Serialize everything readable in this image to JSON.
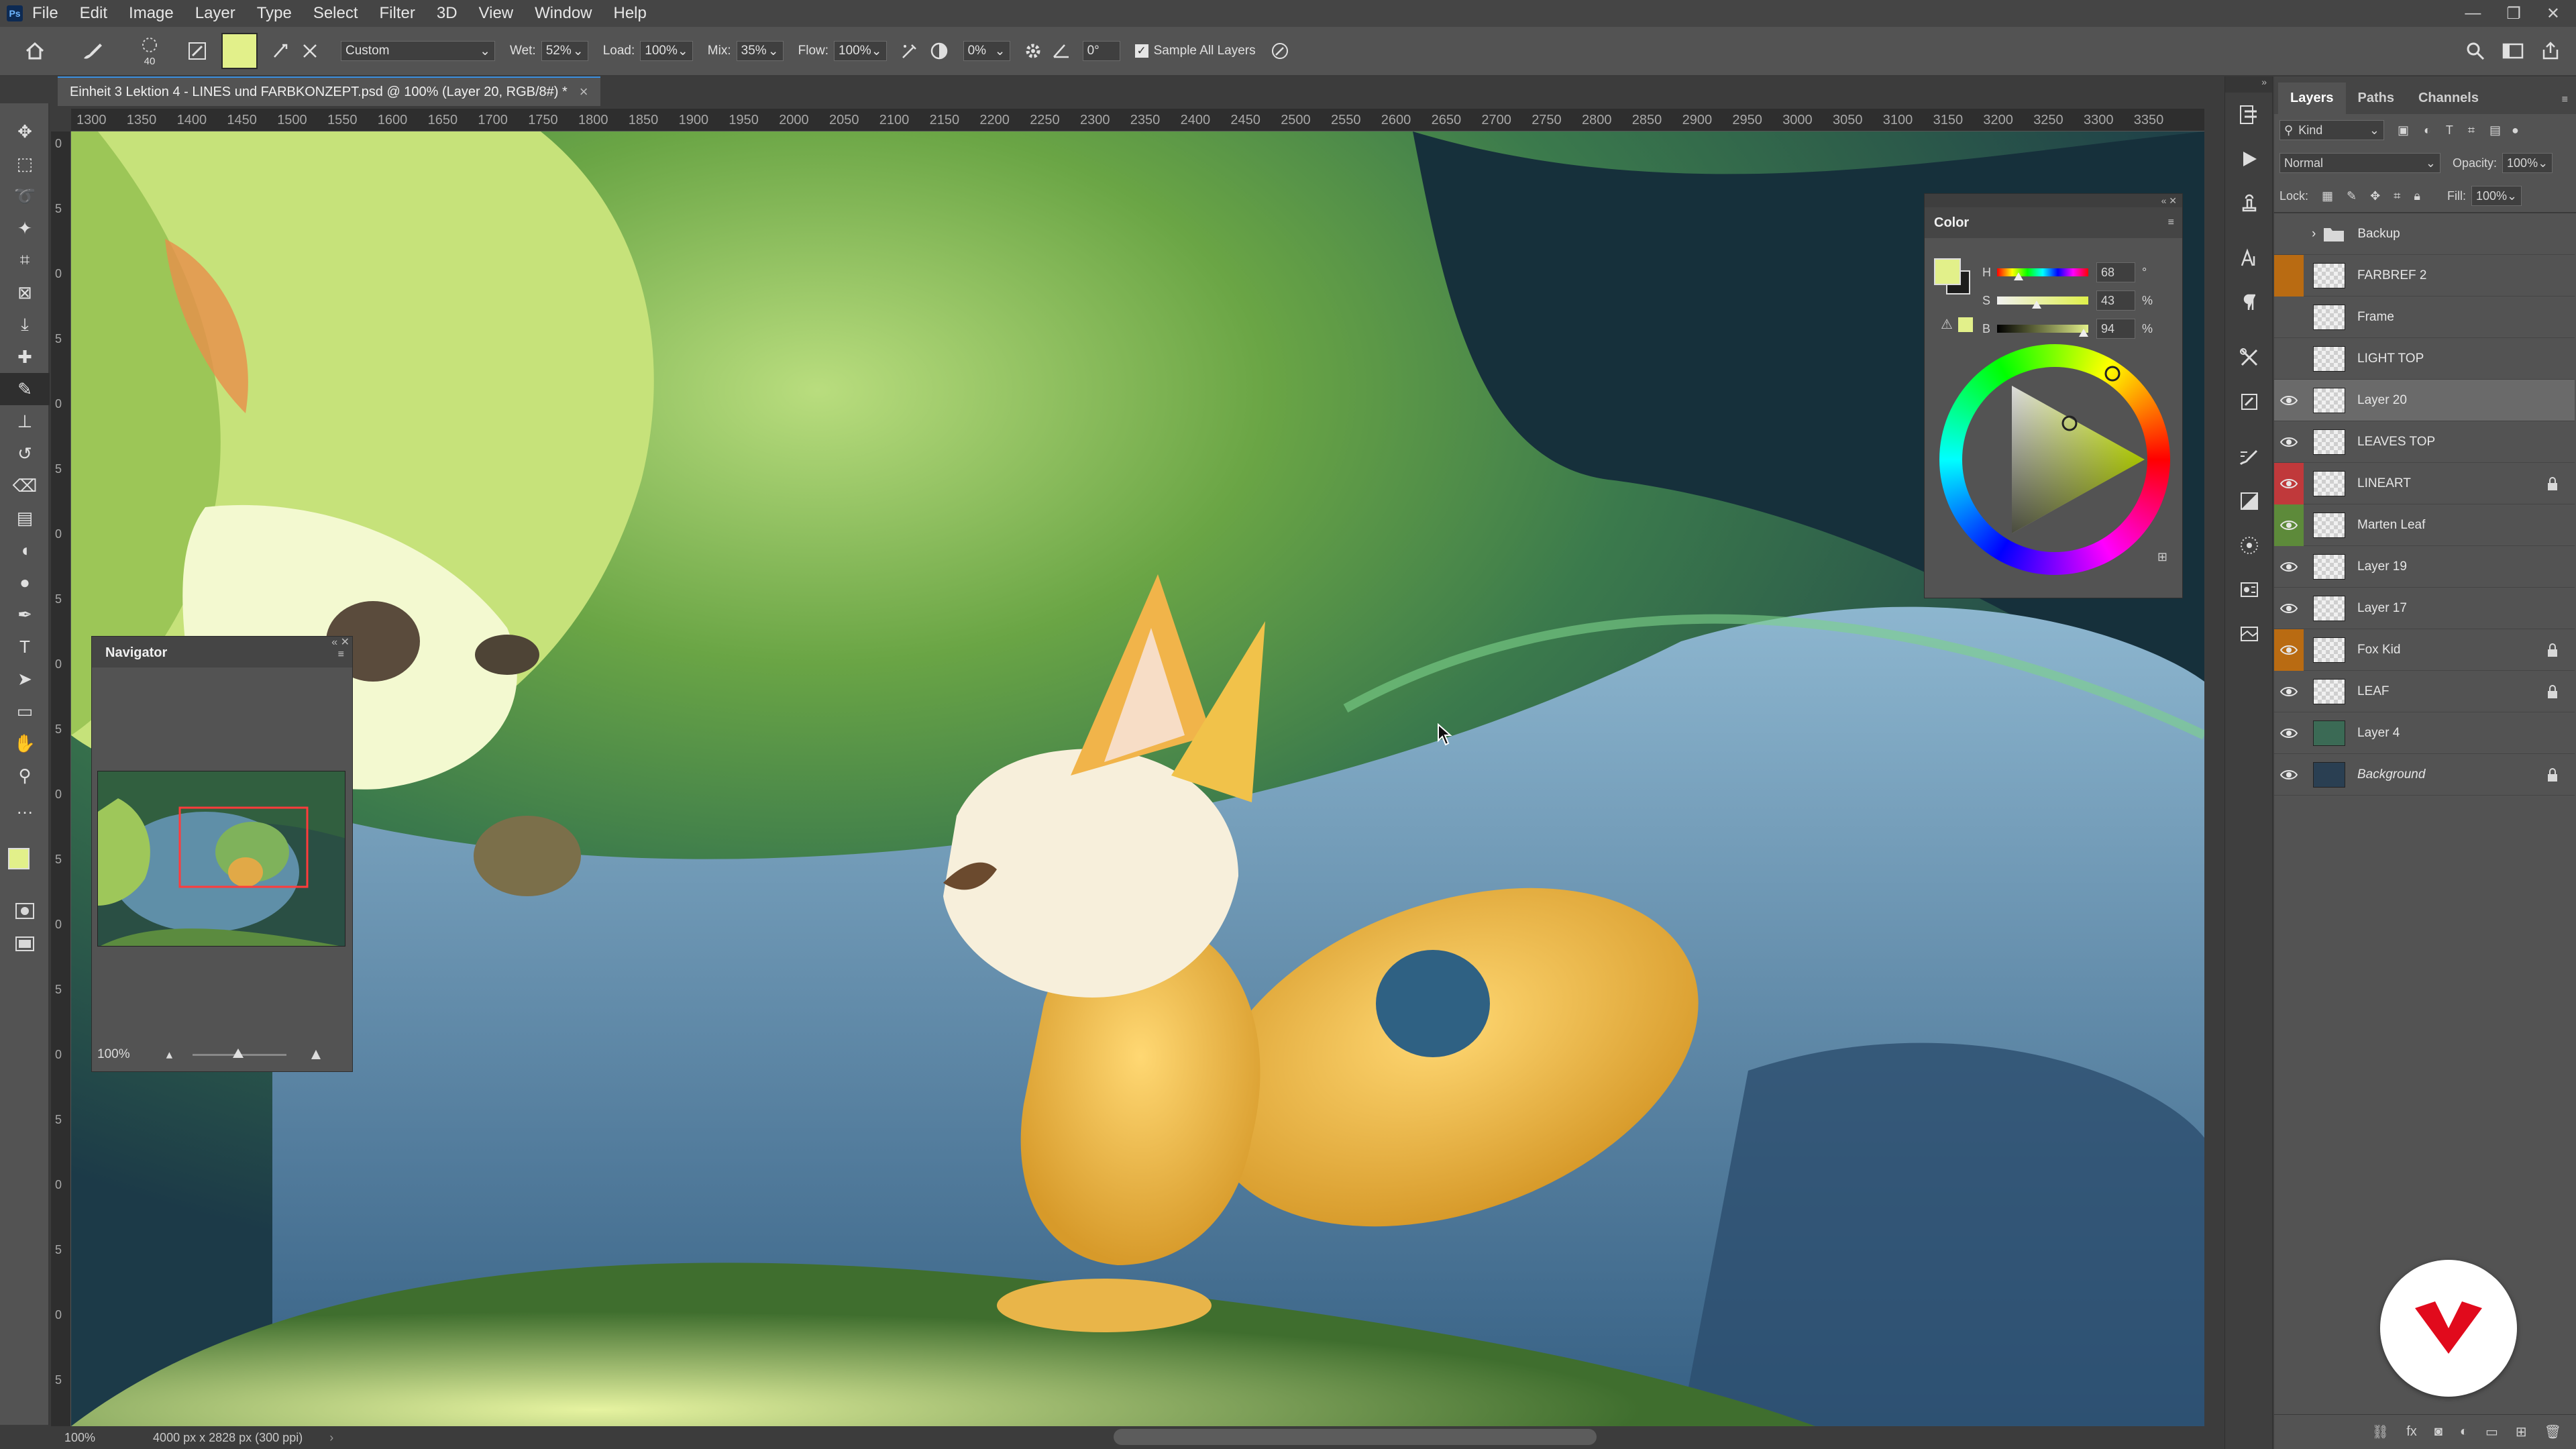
{
  "app": {
    "logo_text": "Ps"
  },
  "menu": [
    "File",
    "Edit",
    "Image",
    "Layer",
    "Type",
    "Select",
    "Filter",
    "3D",
    "View",
    "Window",
    "Help"
  ],
  "window_controls": {
    "minimize": "—",
    "restore": "❐",
    "close": "✕"
  },
  "options_bar": {
    "brush_size": "40",
    "preset": "Custom",
    "wet_label": "Wet:",
    "wet_value": "52%",
    "load_label": "Load:",
    "load_value": "100%",
    "mix_label": "Mix:",
    "mix_value": "35%",
    "flow_label": "Flow:",
    "flow_value": "100%",
    "smoothing_value": "0%",
    "angle_value": "0°",
    "sample_all_label": "Sample All Layers",
    "sample_all_checked": true,
    "swatch_color": "#e2f08a"
  },
  "document": {
    "tab_title": "Einheit 3 Lektion 4 - LINES und FARBKONZEPT.psd @ 100% (Layer 20, RGB/8#) *",
    "close": "×"
  },
  "ruler": {
    "h_ticks": [
      "1300",
      "1350",
      "1400",
      "1450",
      "1500",
      "1550",
      "1600",
      "1650",
      "1700",
      "1750",
      "1800",
      "1850",
      "1900",
      "1950",
      "2000",
      "2050",
      "2100",
      "2150",
      "2200",
      "2250",
      "2300",
      "2350",
      "2400",
      "2450",
      "2500",
      "2550",
      "2600",
      "2650",
      "2700",
      "2750",
      "2800",
      "2850",
      "2900",
      "2950",
      "3000",
      "3050",
      "3100",
      "3150",
      "3200",
      "3250",
      "3300",
      "3350"
    ],
    "v_ticks": [
      "0",
      "5",
      "0",
      "5",
      "0",
      "5",
      "0",
      "5",
      "0",
      "5",
      "0",
      "5",
      "0",
      "5",
      "0",
      "5",
      "0",
      "5",
      "0",
      "5"
    ]
  },
  "status_bar": {
    "zoom": "100%",
    "doc_info": "4000 px x 2828 px (300 ppi)"
  },
  "navigator": {
    "title": "Navigator",
    "zoom": "100%"
  },
  "color_panel": {
    "title": "Color",
    "h_label": "H",
    "h_value": "68",
    "h_unit": "°",
    "s_label": "S",
    "s_value": "43",
    "s_unit": "%",
    "b_label": "B",
    "b_value": "94",
    "b_unit": "%",
    "foreground": "#e2f08a",
    "background": "#1c1c1c"
  },
  "layers_panel": {
    "tabs": [
      "Layers",
      "Paths",
      "Channels"
    ],
    "filter_kind": "Kind",
    "blend_mode": "Normal",
    "opacity_label": "Opacity:",
    "opacity_value": "100%",
    "lock_label": "Lock:",
    "fill_label": "Fill:",
    "fill_value": "100%",
    "layers": [
      {
        "name": "Backup",
        "visible": false,
        "type": "group",
        "locked": false,
        "selected": false,
        "tag": ""
      },
      {
        "name": "FARBREF 2",
        "visible": false,
        "type": "layer",
        "locked": false,
        "selected": false,
        "tag": "#b96b12"
      },
      {
        "name": "Frame",
        "visible": false,
        "type": "layer",
        "locked": false,
        "selected": false,
        "tag": ""
      },
      {
        "name": "LIGHT TOP",
        "visible": false,
        "type": "layer",
        "locked": false,
        "selected": false,
        "tag": ""
      },
      {
        "name": "Layer 20",
        "visible": true,
        "type": "layer",
        "locked": false,
        "selected": true,
        "tag": ""
      },
      {
        "name": "LEAVES TOP",
        "visible": true,
        "type": "layer",
        "locked": false,
        "selected": false,
        "tag": ""
      },
      {
        "name": "LINEART",
        "visible": true,
        "type": "layer",
        "locked": true,
        "selected": false,
        "tag": "#c0393b"
      },
      {
        "name": "Marten Leaf",
        "visible": true,
        "type": "layer",
        "locked": false,
        "selected": false,
        "tag": "#5d8a3a"
      },
      {
        "name": "Layer 19",
        "visible": true,
        "type": "layer",
        "locked": false,
        "selected": false,
        "tag": ""
      },
      {
        "name": "Layer 17",
        "visible": true,
        "type": "layer",
        "locked": false,
        "selected": false,
        "tag": ""
      },
      {
        "name": "Fox Kid",
        "visible": true,
        "type": "layer",
        "locked": true,
        "selected": false,
        "tag": "#b96b12"
      },
      {
        "name": "LEAF",
        "visible": true,
        "type": "layer",
        "locked": true,
        "selected": false,
        "tag": ""
      },
      {
        "name": "Layer 4",
        "visible": true,
        "type": "layer",
        "locked": false,
        "selected": false,
        "tag": ""
      },
      {
        "name": "Background",
        "visible": true,
        "type": "layer",
        "locked": true,
        "selected": false,
        "tag": ""
      }
    ]
  },
  "tools": [
    "move-icon",
    "marquee-icon",
    "lasso-icon",
    "magic-wand-icon",
    "crop-icon",
    "frame-icon",
    "eyedropper-icon",
    "healing-icon",
    "mixer-brush-icon",
    "stamp-icon",
    "history-brush-icon",
    "eraser-icon",
    "gradient-icon",
    "blur-icon",
    "dodge-icon",
    "pen-icon",
    "type-icon",
    "path-select-icon",
    "rectangle-icon",
    "hand-icon",
    "zoom-icon",
    "more-icon"
  ]
}
